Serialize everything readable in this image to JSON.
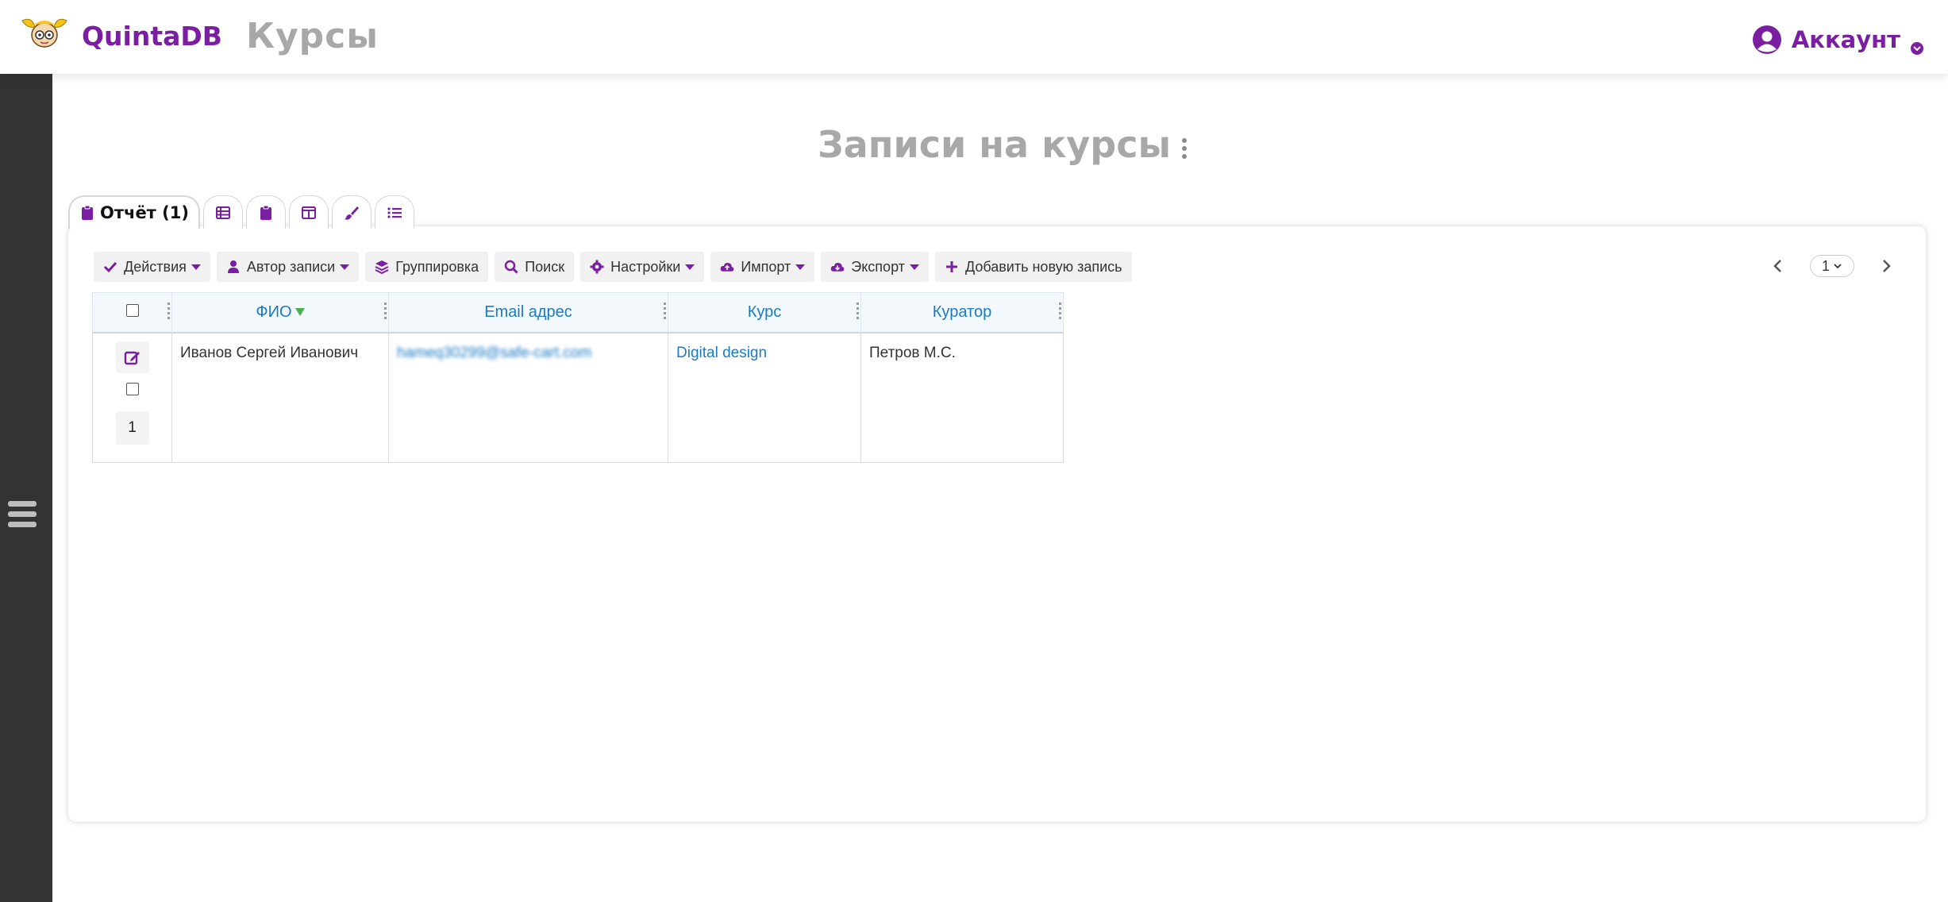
{
  "header": {
    "brand": "QuintaDB",
    "app_title": "Курсы",
    "account_label": "Аккаунт"
  },
  "page": {
    "title": "Записи на курсы"
  },
  "tabs": [
    {
      "label": "Отчёт (1)",
      "icon": "clipboard-icon"
    },
    {
      "icon": "table-list-icon"
    },
    {
      "icon": "clipboard-icon"
    },
    {
      "icon": "columns-icon"
    },
    {
      "icon": "brush-icon"
    },
    {
      "icon": "list-icon"
    }
  ],
  "toolbar": {
    "actions": "Действия",
    "author": "Автор записи",
    "grouping": "Группировка",
    "search": "Поиск",
    "settings": "Настройки",
    "import": "Импорт",
    "export": "Экспорт",
    "add_record": "Добавить новую запись"
  },
  "pager": {
    "current_page": "1"
  },
  "table": {
    "columns": [
      "ФИО",
      "Email адрес",
      "Курс",
      "Куратор"
    ],
    "rows": [
      {
        "row_number": "1",
        "fio": "Иванов Сергей Иванович",
        "email": "hameq30299@safe-cart.com",
        "course": "Digital design",
        "curator": "Петров М.С."
      }
    ]
  },
  "colors": {
    "accent": "#7a1fa2",
    "link": "#1a7bc4",
    "sidebar": "#333333",
    "sort_arrow": "#4caf50"
  }
}
